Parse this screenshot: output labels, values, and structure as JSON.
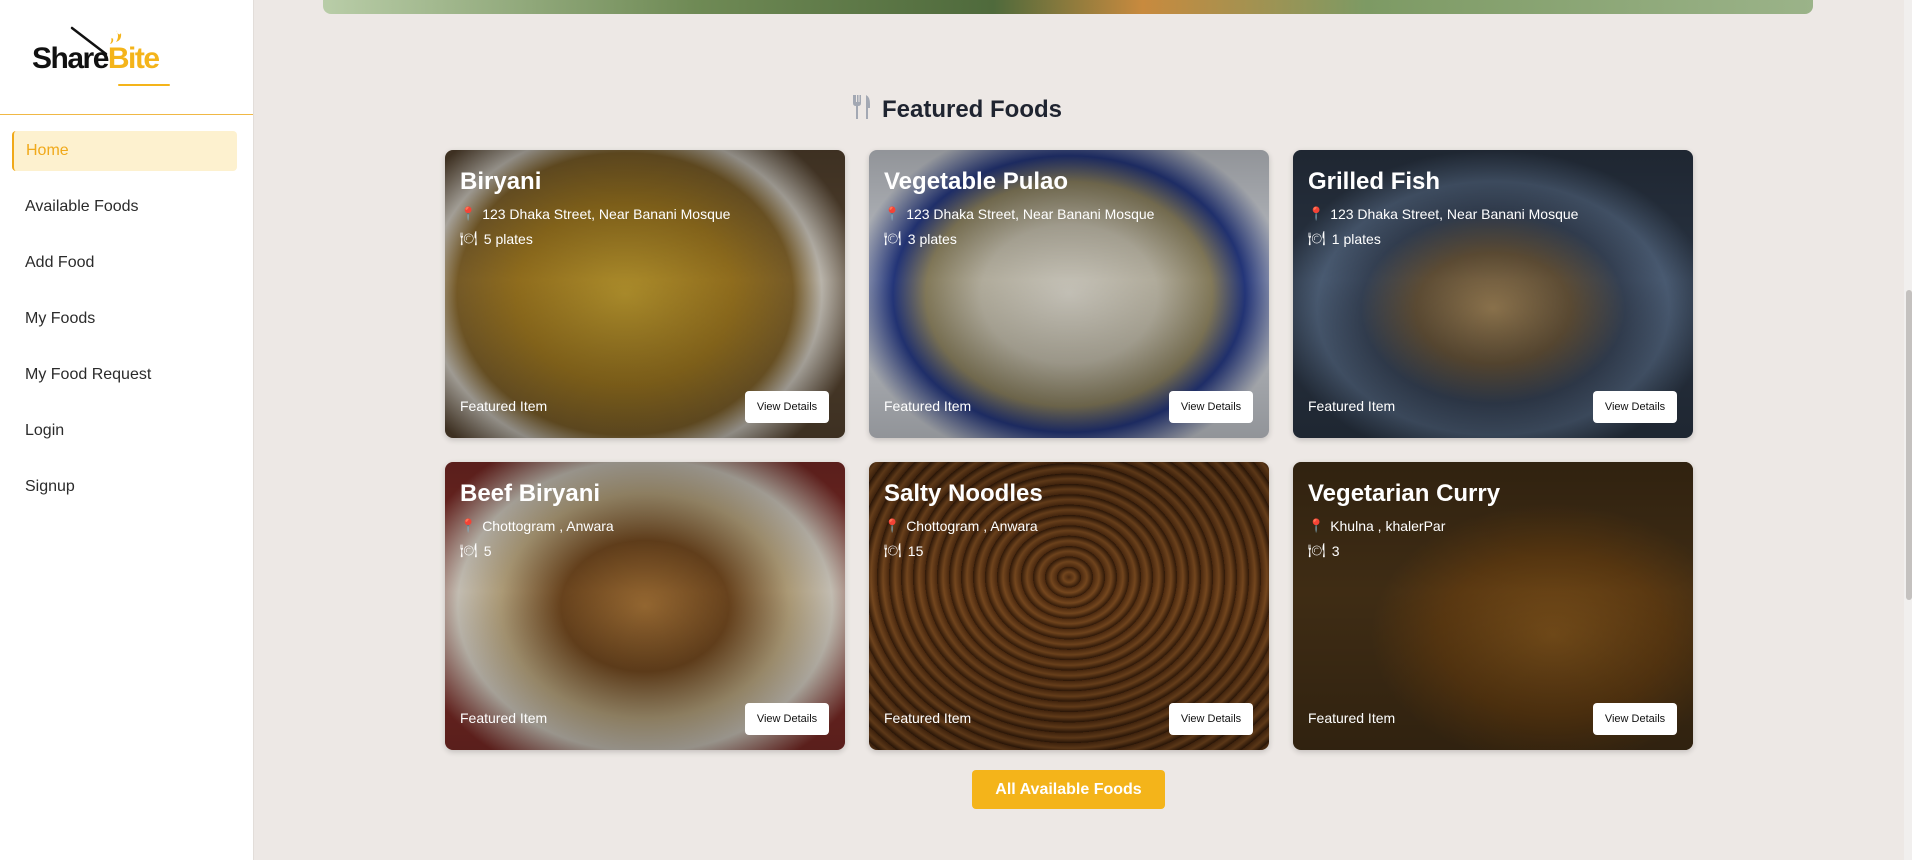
{
  "brand": {
    "share": "Share",
    "bite": "Bite"
  },
  "sidebar": {
    "items": [
      {
        "label": "Home",
        "active": true
      },
      {
        "label": "Available Foods",
        "active": false
      },
      {
        "label": "Add Food",
        "active": false
      },
      {
        "label": "My Foods",
        "active": false
      },
      {
        "label": "My Food Request",
        "active": false
      },
      {
        "label": "Login",
        "active": false
      },
      {
        "label": "Signup",
        "active": false
      }
    ]
  },
  "featured": {
    "title": "Featured Foods",
    "icon": "fork-knife-icon",
    "cards": [
      {
        "name": "Biryani",
        "location": "123 Dhaka Street, Near Banani Mosque",
        "quantity": "5 plates",
        "badge": "Featured Item",
        "button": "View Details"
      },
      {
        "name": "Vegetable Pulao",
        "location": "123 Dhaka Street, Near Banani Mosque",
        "quantity": "3 plates",
        "badge": "Featured Item",
        "button": "View Details"
      },
      {
        "name": "Grilled Fish",
        "location": "123 Dhaka Street, Near Banani Mosque",
        "quantity": "1 plates",
        "badge": "Featured Item",
        "button": "View Details"
      },
      {
        "name": "Beef Biryani",
        "location": "Chottogram , Anwara",
        "quantity": "5",
        "badge": "Featured Item",
        "button": "View Details"
      },
      {
        "name": "Salty Noodles",
        "location": "Chottogram , Anwara",
        "quantity": "15",
        "badge": "Featured Item",
        "button": "View Details"
      },
      {
        "name": "Vegetarian Curry",
        "location": "Khulna , khalerPar",
        "quantity": "3",
        "badge": "Featured Item",
        "button": "View Details"
      }
    ],
    "all_button": "All Available Foods"
  },
  "colors": {
    "accent": "#f4b41a",
    "background": "#ede8e5",
    "text": "#1f2430"
  }
}
